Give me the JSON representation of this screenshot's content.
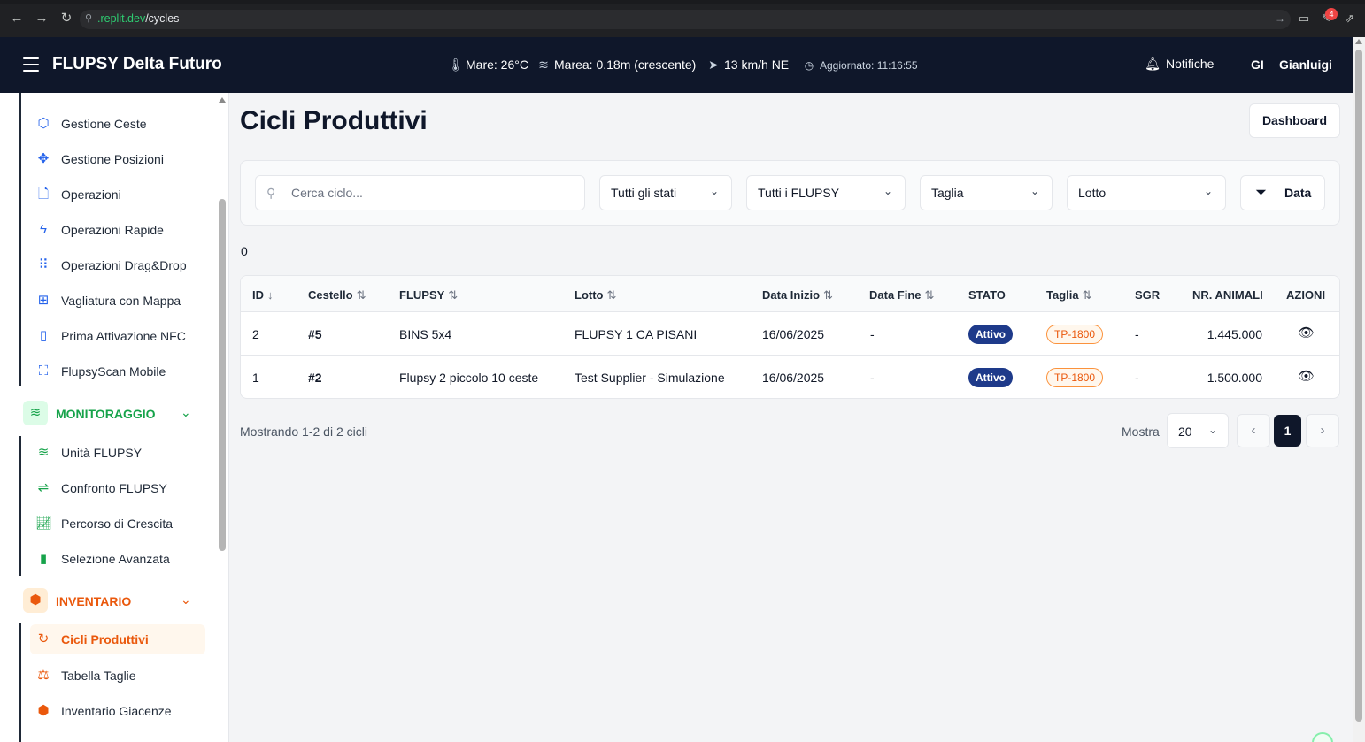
{
  "browser": {
    "url_host": ".replit.dev",
    "url_path": "/cycles",
    "extension_badge": "4"
  },
  "header": {
    "title": "FLUPSY Delta Futuro",
    "sea_temp": "Mare: 26°C",
    "tide": "Marea: 0.18m (crescente)",
    "wind": "13 km/h NE",
    "updated": "Aggiornato: 11:16:55",
    "notifications_label": "Notifiche",
    "user_initials": "GI",
    "user_name": "Gianluigi"
  },
  "sidebar": {
    "items_top": [
      {
        "label": "Gestione Ceste",
        "icon": "box-icon"
      },
      {
        "label": "Gestione Posizioni",
        "icon": "move-icon"
      },
      {
        "label": "Operazioni",
        "icon": "document-icon"
      },
      {
        "label": "Operazioni Rapide",
        "icon": "lightning-icon"
      },
      {
        "label": "Operazioni Drag&Drop",
        "icon": "grip-icon"
      },
      {
        "label": "Vagliatura con Mappa",
        "icon": "grid-icon"
      },
      {
        "label": "Prima Attivazione NFC",
        "icon": "phone-icon"
      },
      {
        "label": "FlupsyScan Mobile",
        "icon": "scan-icon"
      }
    ],
    "monitoraggio": {
      "title": "MONITORAGGIO",
      "items": [
        {
          "label": "Unità FLUPSY",
          "icon": "waves-icon"
        },
        {
          "label": "Confronto FLUPSY",
          "icon": "compare-icon"
        },
        {
          "label": "Percorso di Crescita",
          "icon": "line-chart-icon"
        },
        {
          "label": "Selezione Avanzata",
          "icon": "bar-chart-icon"
        }
      ]
    },
    "inventario": {
      "title": "INVENTARIO",
      "items": [
        {
          "label": "Cicli Produttivi",
          "icon": "refresh-icon",
          "active": true
        },
        {
          "label": "Tabella Taglie",
          "icon": "scale-icon"
        },
        {
          "label": "Inventario Giacenze",
          "icon": "boxes-icon"
        }
      ]
    },
    "colors": {
      "blue": "#2563eb",
      "green": "#16a34a",
      "orange": "#ea580c"
    }
  },
  "main": {
    "title": "Cicli Produttivi",
    "dashboard_button": "Dashboard",
    "search_placeholder": "Cerca ciclo...",
    "filters": {
      "stato": "Tutti gli stati",
      "flupsy": "Tutti i FLUPSY",
      "taglia": "Taglia",
      "lotto": "Lotto",
      "data_button": "Data"
    },
    "count": "0",
    "table": {
      "headers": [
        "ID",
        "Cestello",
        "FLUPSY",
        "Lotto",
        "Data Inizio",
        "Data Fine",
        "STATO",
        "Taglia",
        "SGR",
        "NR. ANIMALI",
        "AZIONI"
      ],
      "rows": [
        {
          "id": "2",
          "cestello": "#5",
          "flupsy": "BINS 5x4",
          "lotto": "FLUPSY 1 CA PISANI",
          "data_inizio": "16/06/2025",
          "data_fine": "-",
          "stato": "Attivo",
          "taglia": "TP-1800",
          "sgr": "-",
          "animali": "1.445.000"
        },
        {
          "id": "1",
          "cestello": "#2",
          "flupsy": "Flupsy 2 piccolo 10 ceste",
          "lotto": "Test Supplier - Simulazione",
          "data_inizio": "16/06/2025",
          "data_fine": "-",
          "stato": "Attivo",
          "taglia": "TP-1800",
          "sgr": "-",
          "animali": "1.500.000"
        }
      ]
    },
    "pagination": {
      "summary": "Mostrando 1-2 di 2 cicli",
      "show_label": "Mostra",
      "page_size": "20",
      "current_page": "1"
    }
  }
}
